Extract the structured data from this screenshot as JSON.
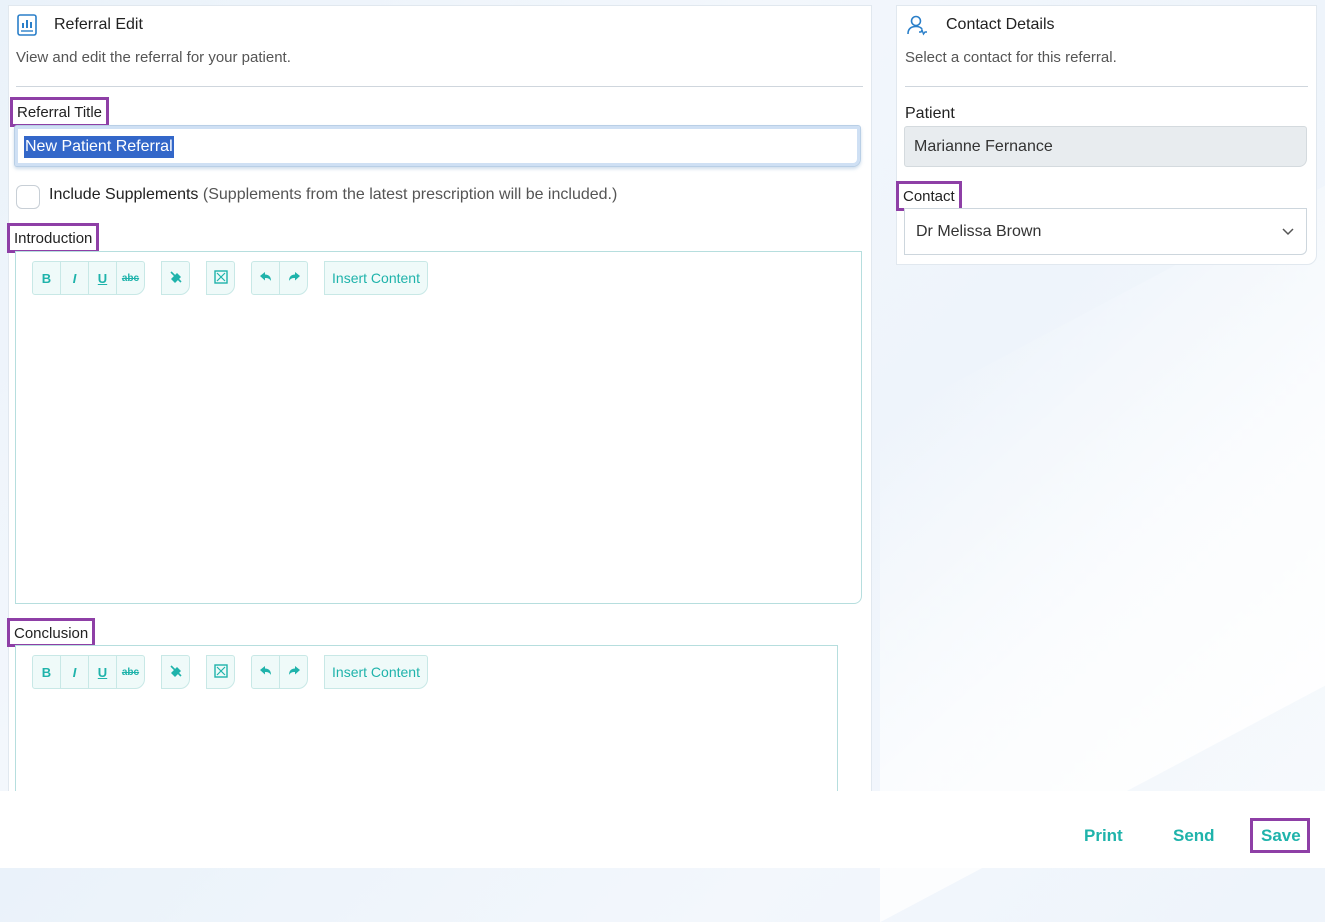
{
  "referral_card": {
    "title": "Referral Edit",
    "subtitle": "View and edit the referral for your patient.",
    "icon": "report-icon",
    "title_label": "Referral Title",
    "title_value": "New Patient Referral",
    "supplements_label": "Include Supplements",
    "supplements_note": "(Supplements from the latest prescription will be included.)",
    "supplements_checked": false,
    "introduction_label": "Introduction",
    "conclusion_label": "Conclusion",
    "toolbar": {
      "bold": "B",
      "italic": "I",
      "underline": "U",
      "strike": "abc",
      "insert_content": "Insert Content"
    }
  },
  "contact_card": {
    "title": "Contact Details",
    "subtitle": "Select a contact for this referral.",
    "icon": "user-icon",
    "patient_label": "Patient",
    "patient_value": "Marianne Fernance",
    "contact_label": "Contact",
    "contact_value": "Dr Melissa Brown"
  },
  "footer": {
    "print": "Print",
    "send": "Send",
    "save": "Save"
  },
  "colors": {
    "accent": "#1fb3ab",
    "highlight_border": "#8e3fa6",
    "selection": "#3367c9"
  }
}
